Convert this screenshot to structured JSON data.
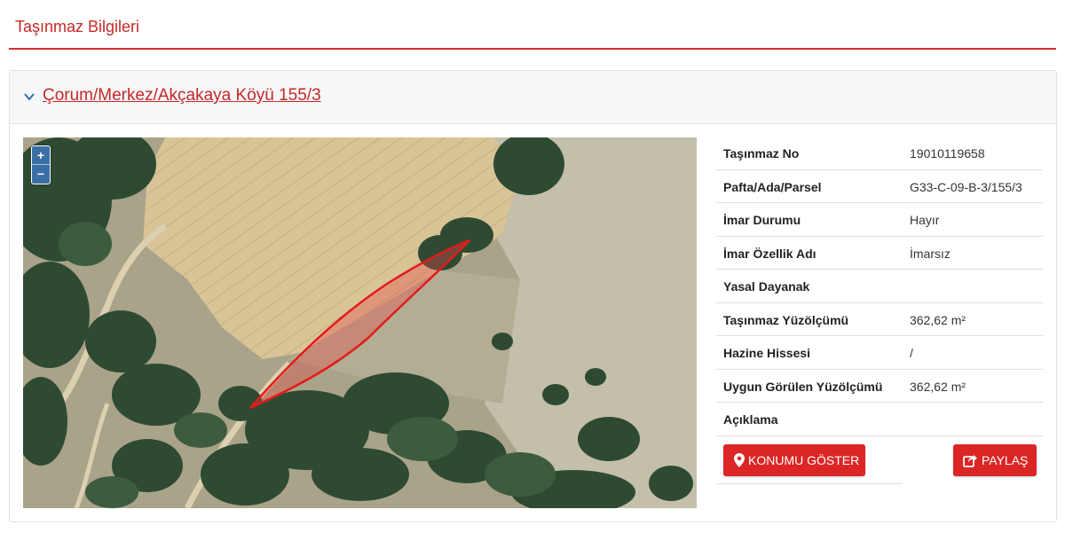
{
  "page": {
    "title": "Taşınmaz Bilgileri"
  },
  "parcel": {
    "heading": "Çorum/Merkez/Akçakaya Köyü 155/3"
  },
  "map": {
    "zoom_in": "+",
    "zoom_out": "−"
  },
  "info_rows": [
    {
      "label": "Taşınmaz No",
      "value": "19010119658"
    },
    {
      "label": "Pafta/Ada/Parsel",
      "value": "G33-C-09-B-3/155/3"
    },
    {
      "label": "İmar Durumu",
      "value": "Hayır"
    },
    {
      "label": "İmar Özellik Adı",
      "value": "İmarsız"
    },
    {
      "label": "Yasal Dayanak",
      "value": ""
    },
    {
      "label": "Taşınmaz Yüzölçümü",
      "value": "362,62 m²"
    },
    {
      "label": "Hazine Hissesi",
      "value": "/"
    },
    {
      "label": "Uygun Görülen Yüzölçümü",
      "value": "362,62 m²"
    },
    {
      "label": "Açıklama",
      "value": ""
    }
  ],
  "buttons": {
    "locate": "KONUMU GÖSTER",
    "share": "PAYLAŞ"
  },
  "colors": {
    "accent": "#dc2626",
    "header_text": "#c62828",
    "zoom_control": "#3b6ea5"
  }
}
